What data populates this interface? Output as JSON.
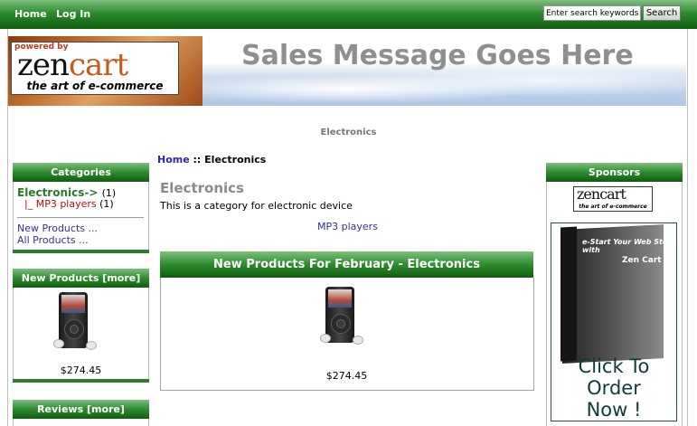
{
  "topnav": {
    "home": "Home",
    "login": "Log In",
    "search_placeholder": "Enter search keywords here",
    "search_button": "Search"
  },
  "header": {
    "logo_powered": "powered by",
    "logo_zen": "zen",
    "logo_cart": "cart",
    "logo_tagline": "the art of e-commerce",
    "sales_message": "Sales Message Goes Here"
  },
  "category_heading": "Electronics",
  "left": {
    "categories": {
      "title": "Categories",
      "main_link": "Electronics->",
      "main_count": "(1)",
      "sub_link": "|_ MP3 players",
      "sub_count": "(1)",
      "new_products": "New Products ...",
      "all_products": "All Products ..."
    },
    "new_products": {
      "title": "New Products  [more]",
      "price": "$274.45"
    },
    "reviews": {
      "title": "Reviews  [more]"
    }
  },
  "center": {
    "breadcrumb_home": "Home",
    "breadcrumb_sep": " :: ",
    "breadcrumb_current": "Electronics",
    "title": "Electronics",
    "description": "This is a category for electronic device",
    "subcategory_link": "MP3 players",
    "new_products_heading": "New Products For February - Electronics",
    "product_price": "$274.45"
  },
  "right": {
    "sponsors_title": "Sponsors",
    "sponsor_logo_zen": "zencart",
    "sponsor_logo_tag": "the art of e-commerce",
    "ad_book_title": "e-Start Your Web Store with",
    "ad_book_brand": "Zen Cart",
    "ad_cta_line1": "Click To",
    "ad_cta_line2": "Order",
    "ad_cta_line3": "Now !"
  }
}
